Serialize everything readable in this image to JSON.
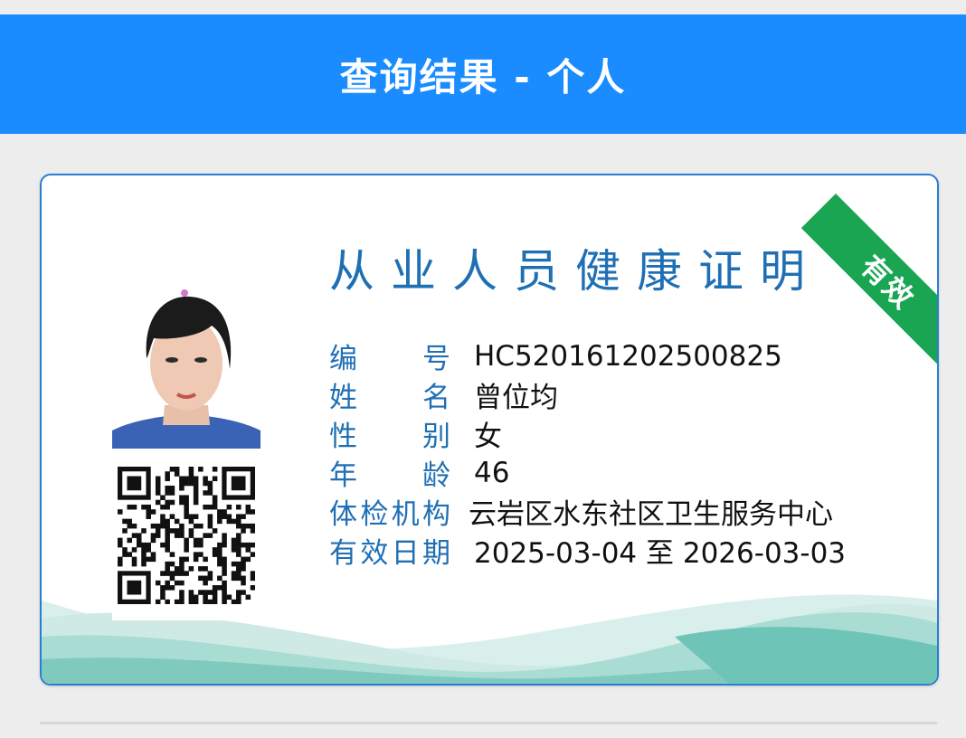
{
  "header": {
    "title": "查询结果 - 个人"
  },
  "card": {
    "title": "从业人员健康证明",
    "status_badge": "有效",
    "fields": [
      {
        "label_chars": [
          "编",
          "号"
        ],
        "value": "HC520161202500825"
      },
      {
        "label_chars": [
          "姓",
          "名"
        ],
        "value": "曾位均"
      },
      {
        "label_chars": [
          "性",
          "别"
        ],
        "value": "女"
      },
      {
        "label_chars": [
          "年",
          "龄"
        ],
        "value": "46"
      },
      {
        "label_chars": [
          "体",
          "检",
          "机",
          "构"
        ],
        "value": "云岩区水东社区卫生服务中心"
      },
      {
        "label_chars": [
          "有",
          "效",
          "日",
          "期"
        ],
        "value": "2025-03-04 至 2026-03-03"
      }
    ]
  },
  "colors": {
    "header_bg": "#1a8cff",
    "card_border": "#2a7fd0",
    "label_blue": "#1f6fb5",
    "badge_green": "#1aa552",
    "wave_light": "#cfe9e5",
    "wave_mid": "#a9dcd3",
    "wave_dark": "#6fc4b8"
  },
  "icons": {
    "photo": "id-photo",
    "qr": "qr-code-icon"
  }
}
